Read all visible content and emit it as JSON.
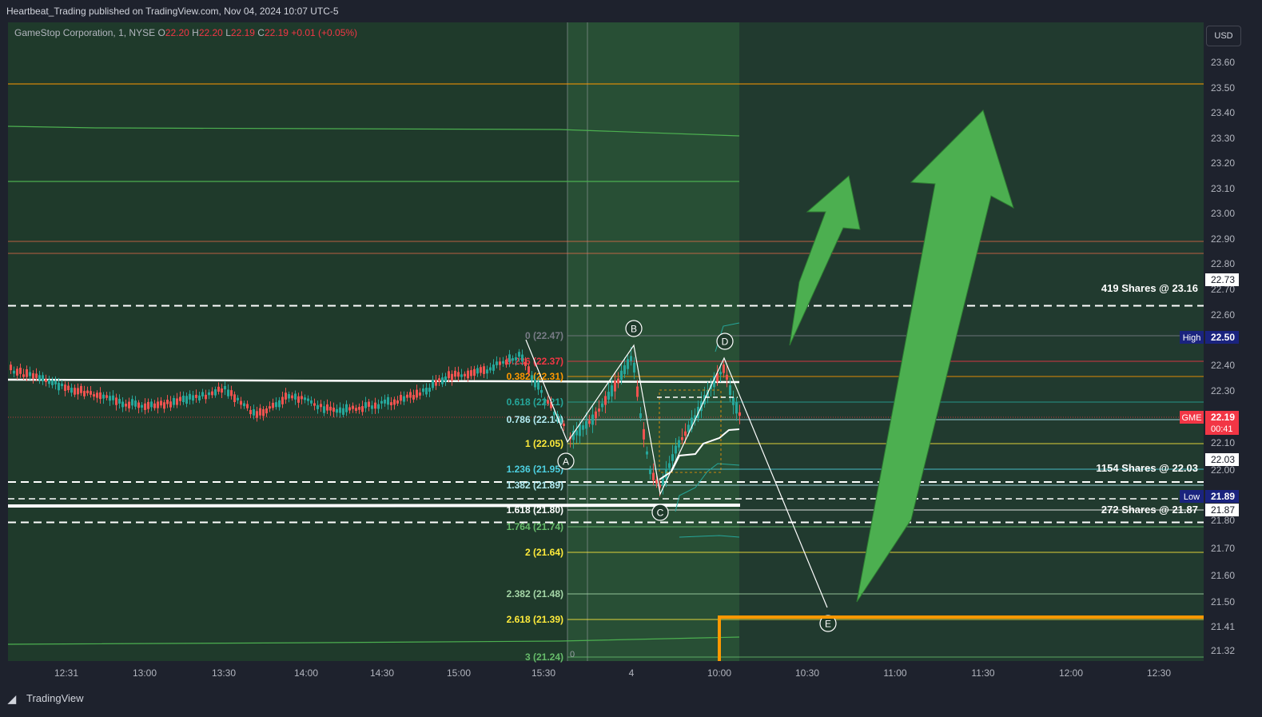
{
  "header": {
    "title": "Heartbeat_Trading published on TradingView.com, Nov 04, 2024 10:07 UTC-5"
  },
  "symbol": {
    "name": "GameStop Corporation, 1, NYSE",
    "o_label": "O",
    "o": "22.20",
    "h_label": "H",
    "h": "22.20",
    "l_label": "L",
    "l": "22.19",
    "c_label": "C",
    "c": "22.19",
    "change": "+0.01 (+0.05%)"
  },
  "currency_button": "USD",
  "footer": {
    "brand": "TradingView"
  },
  "colors": {
    "bg": "#1e222d",
    "chart_bg": "#1f3a2b",
    "up": "#26a69a",
    "down": "#ef5350",
    "arrow": "#4caf50",
    "orange": "#ff9800"
  },
  "chart_data": {
    "type": "candlestick",
    "ylim": [
      21.27,
      23.75
    ],
    "price_ticks": [
      "23.60",
      "23.50",
      "23.40",
      "23.30",
      "23.20",
      "23.10",
      "23.00",
      "22.90",
      "22.80",
      "22.70",
      "22.60",
      "22.40",
      "22.30",
      "22.10",
      "22.00",
      "21.80",
      "21.70",
      "21.60",
      "21.50",
      "21.41",
      "21.32"
    ],
    "time_ticks": [
      "12:31",
      "13:00",
      "13:30",
      "14:00",
      "14:30",
      "15:00",
      "15:30",
      "4",
      "10:00",
      "10:30",
      "11:00",
      "11:30",
      "12:00",
      "12:30"
    ],
    "price_labels": [
      {
        "text": "22.73",
        "price": 22.73,
        "style": "white"
      },
      {
        "tag": "High",
        "text": "22.50",
        "price": 22.5,
        "style": "navy"
      },
      {
        "tag": "GME",
        "text": "22.19",
        "sub": "00:41",
        "price": 22.19,
        "style": "red"
      },
      {
        "text": "22.03",
        "price": 22.03,
        "style": "white"
      },
      {
        "tag": "Low",
        "text": "21.89",
        "price": 21.89,
        "style": "navy"
      },
      {
        "text": "21.87",
        "price": 21.87,
        "style": "white"
      }
    ],
    "order_lines": [
      {
        "label": "419 Shares @ 23.16",
        "price": 22.73
      },
      {
        "label": "1154 Shares @ 22.03",
        "price": 22.03
      },
      {
        "label": "272 Shares @ 21.87",
        "price": 21.87
      }
    ],
    "fib_levels": [
      {
        "label": "0 (22.47)",
        "price": 22.47,
        "color": "#787b86"
      },
      {
        "label": "0.236 (22.37)",
        "price": 22.37,
        "color": "#f23645"
      },
      {
        "label": "0.382 (22.31)",
        "price": 22.31,
        "color": "#ff9800"
      },
      {
        "label": "0.618 (22.21)",
        "price": 22.21,
        "color": "#26a69a"
      },
      {
        "label": "0.786 (22.14)",
        "price": 22.14,
        "color": "#b2ebf2"
      },
      {
        "label": "1 (22.05)",
        "price": 22.05,
        "color": "#ffeb3b"
      },
      {
        "label": "1.236 (21.95)",
        "price": 21.95,
        "color": "#4dd0e1"
      },
      {
        "label": "1.382 (21.89)",
        "price": 21.89,
        "color": "#b2ebf2"
      },
      {
        "label": "1.618 (21.80)",
        "price": 21.8,
        "color": "#ffffff"
      },
      {
        "label": "1.764 (21.74)",
        "price": 21.74,
        "color": "#66bb6a"
      },
      {
        "label": "2 (21.64)",
        "price": 21.64,
        "color": "#ffeb3b"
      },
      {
        "label": "2.382 (21.48)",
        "price": 21.48,
        "color": "#a5d6a7"
      },
      {
        "label": "2.618 (21.39)",
        "price": 21.39,
        "color": "#ffeb3b"
      },
      {
        "label": "3 (21.24)",
        "price": 21.24,
        "color": "#66bb6a"
      }
    ],
    "pattern_points": [
      "A",
      "B",
      "C",
      "D",
      "E"
    ],
    "zero_label": "0"
  }
}
